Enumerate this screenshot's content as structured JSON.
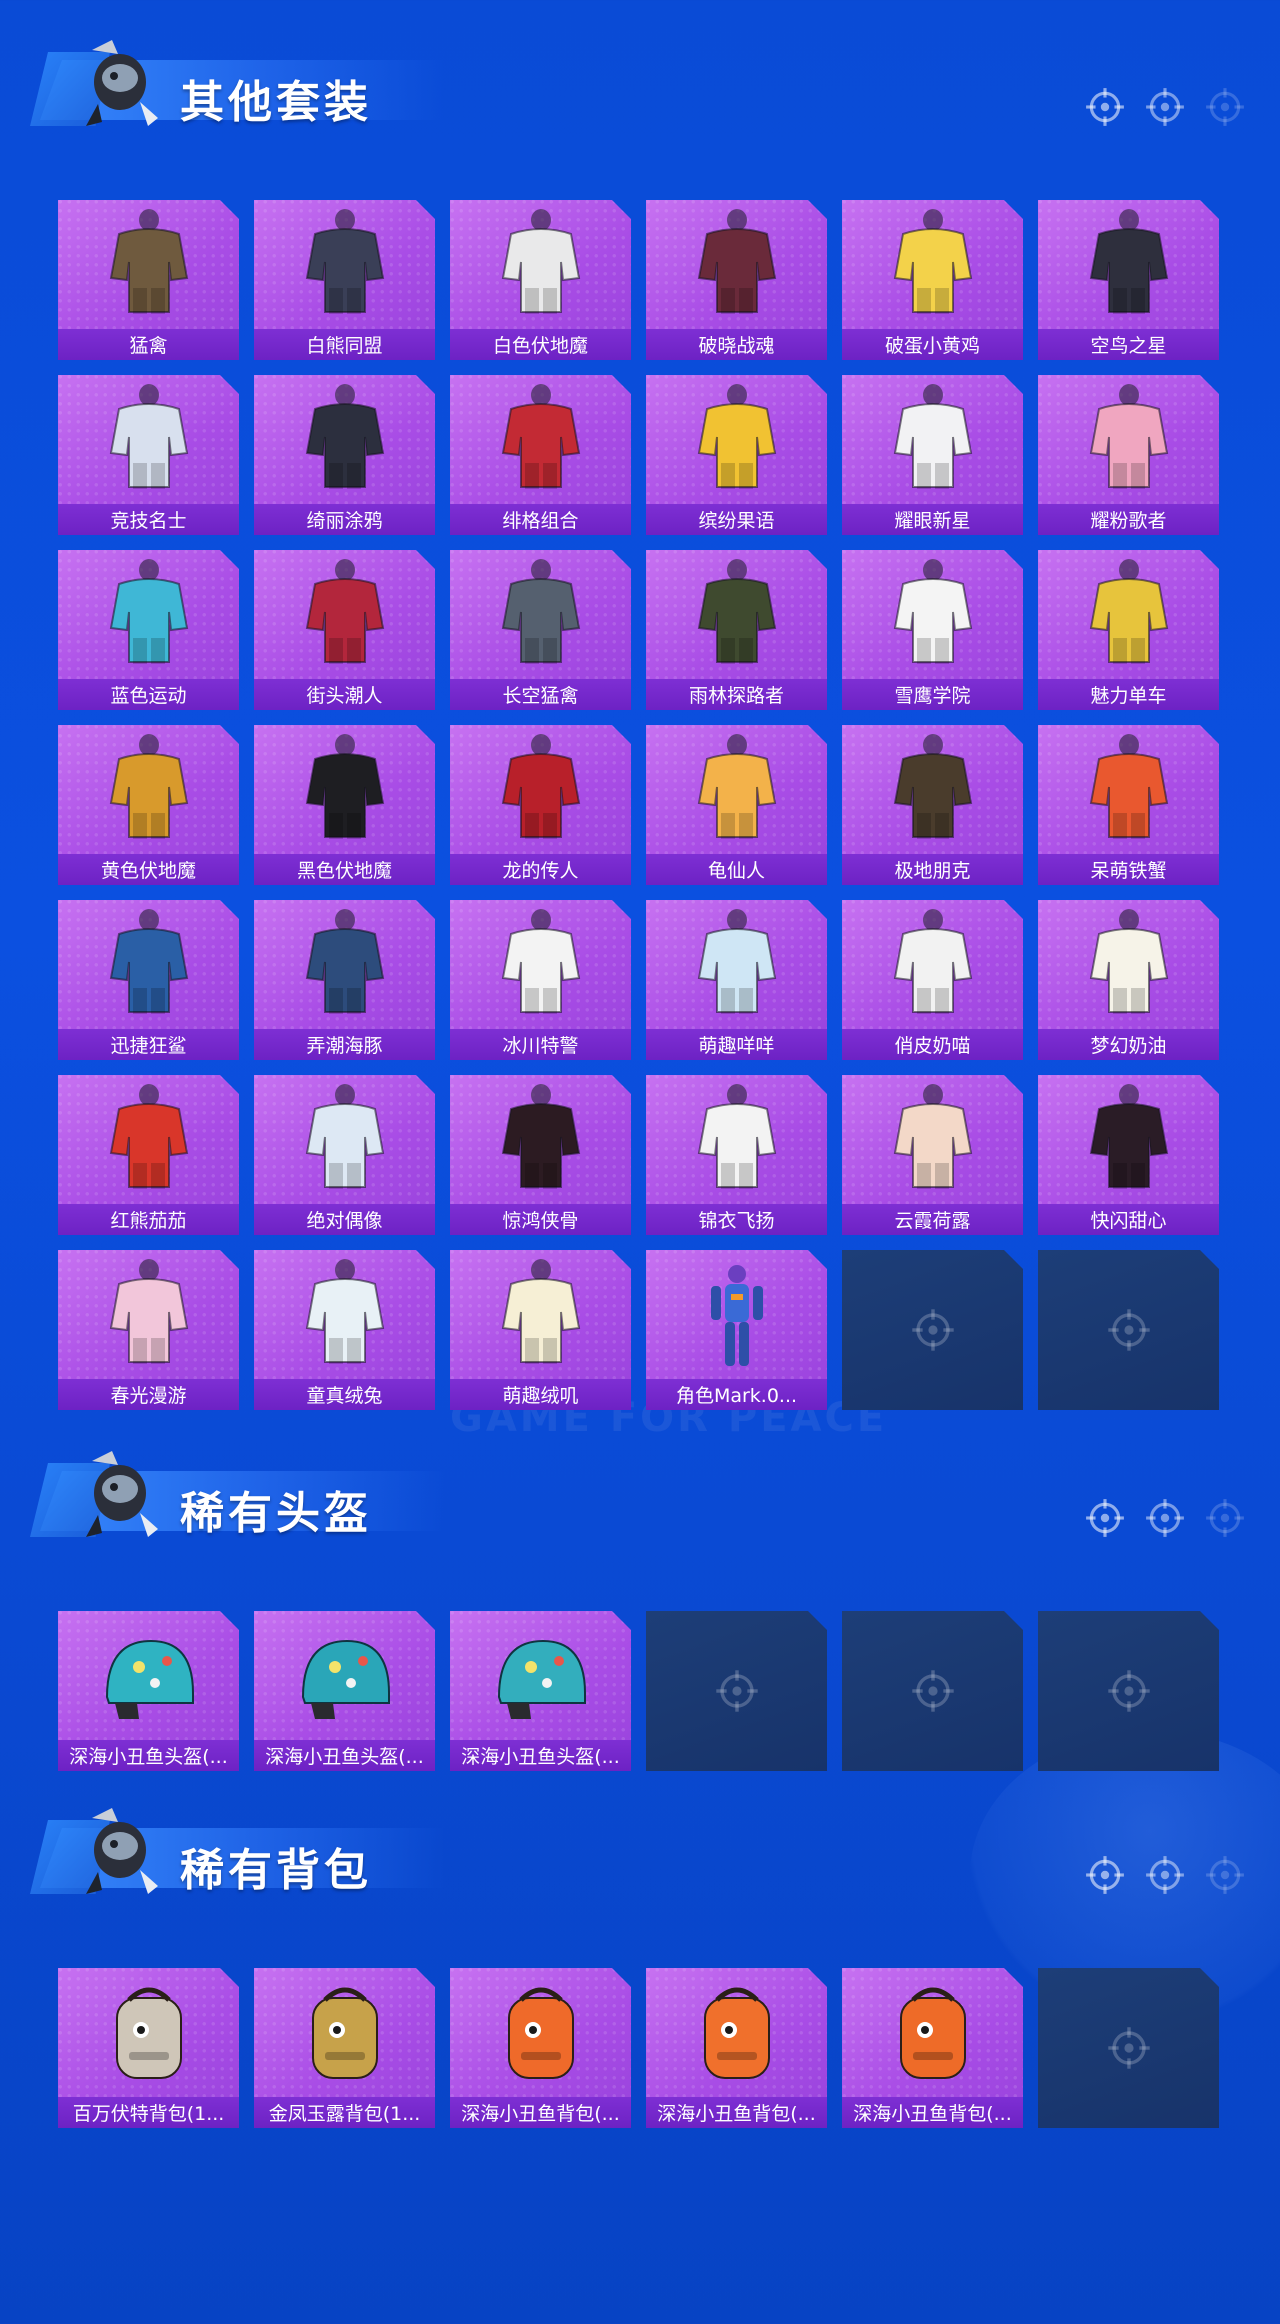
{
  "sections": [
    {
      "title": "其他套装",
      "items": [
        {
          "label": "猛禽",
          "icon": "outfit-icon",
          "color": "#6f5a3e"
        },
        {
          "label": "白熊同盟",
          "icon": "outfit-icon",
          "color": "#3a3f57"
        },
        {
          "label": "白色伏地魔",
          "icon": "outfit-icon",
          "color": "#e9e9ea"
        },
        {
          "label": "破晓战魂",
          "icon": "outfit-icon",
          "color": "#6a2a3a"
        },
        {
          "label": "破蛋小黄鸡",
          "icon": "outfit-icon",
          "color": "#f3d24a"
        },
        {
          "label": "空鸟之星",
          "icon": "outfit-icon",
          "color": "#2e2f3d"
        },
        {
          "label": "竞技名士",
          "icon": "outfit-icon",
          "color": "#d8e0ee"
        },
        {
          "label": "绮丽涂鸦",
          "icon": "outfit-icon",
          "color": "#2c2f3e"
        },
        {
          "label": "绯格组合",
          "icon": "outfit-icon",
          "color": "#c32a34"
        },
        {
          "label": "缤纷果语",
          "icon": "outfit-icon",
          "color": "#f1c232"
        },
        {
          "label": "耀眼新星",
          "icon": "outfit-icon",
          "color": "#f2f2f4"
        },
        {
          "label": "耀粉歌者",
          "icon": "outfit-icon",
          "color": "#f0a6c0"
        },
        {
          "label": "蓝色运动",
          "icon": "outfit-icon",
          "color": "#3fb7d6"
        },
        {
          "label": "街头潮人",
          "icon": "outfit-icon",
          "color": "#b3263c"
        },
        {
          "label": "长空猛禽",
          "icon": "outfit-icon",
          "color": "#55606f"
        },
        {
          "label": "雨林探路者",
          "icon": "outfit-icon",
          "color": "#3f4a2f"
        },
        {
          "label": "雪鹰学院",
          "icon": "outfit-icon",
          "color": "#f4f4f4"
        },
        {
          "label": "魅力单车",
          "icon": "outfit-icon",
          "color": "#e7c43c"
        },
        {
          "label": "黄色伏地魔",
          "icon": "outfit-icon",
          "color": "#d89a2c"
        },
        {
          "label": "黑色伏地魔",
          "icon": "outfit-icon",
          "color": "#1e1e22"
        },
        {
          "label": "龙的传人",
          "icon": "outfit-icon",
          "color": "#b8202a"
        },
        {
          "label": "龟仙人",
          "icon": "outfit-icon",
          "color": "#f3b24a"
        },
        {
          "label": "极地朋克",
          "icon": "outfit-icon",
          "color": "#4a3c2c"
        },
        {
          "label": "呆萌铁蟹",
          "icon": "outfit-icon",
          "color": "#e9582f"
        },
        {
          "label": "迅捷狂鲨",
          "icon": "outfit-icon",
          "color": "#2a5fa6"
        },
        {
          "label": "弄潮海豚",
          "icon": "outfit-icon",
          "color": "#2d4c7c"
        },
        {
          "label": "冰川特警",
          "icon": "outfit-icon",
          "color": "#f3f3f3"
        },
        {
          "label": "萌趣咩咩",
          "icon": "outfit-icon",
          "color": "#cfe6f5"
        },
        {
          "label": "俏皮奶喵",
          "icon": "outfit-icon",
          "color": "#f2f2f2"
        },
        {
          "label": "梦幻奶油",
          "icon": "outfit-icon",
          "color": "#f6f3e8"
        },
        {
          "label": "红熊茄茄",
          "icon": "outfit-icon",
          "color": "#d9362a"
        },
        {
          "label": "绝对偶像",
          "icon": "outfit-icon",
          "color": "#dde8f4"
        },
        {
          "label": "惊鸿侠骨",
          "icon": "outfit-icon",
          "color": "#2c1b22"
        },
        {
          "label": "锦衣飞扬",
          "icon": "outfit-icon",
          "color": "#f3f3f3"
        },
        {
          "label": "云霞荷露",
          "icon": "outfit-icon",
          "color": "#f3d8c8"
        },
        {
          "label": "快闪甜心",
          "icon": "outfit-icon",
          "color": "#2a1c26"
        },
        {
          "label": "春光漫游",
          "icon": "outfit-icon",
          "color": "#f2c6da"
        },
        {
          "label": "童真绒兔",
          "icon": "outfit-icon",
          "color": "#e8f1f6"
        },
        {
          "label": "萌趣绒叽",
          "icon": "outfit-icon",
          "color": "#f6efd5"
        },
        {
          "label": "角色Mark.0...",
          "icon": "mech-suit-icon",
          "color": "#3a6ad6"
        }
      ],
      "total_slots": 42
    },
    {
      "title": "稀有头盔",
      "items": [
        {
          "label": "深海小丑鱼头盔(...",
          "icon": "helmet-icon",
          "color": "#2fb3c2"
        },
        {
          "label": "深海小丑鱼头盔(...",
          "icon": "helmet-icon",
          "color": "#2aa6b8"
        },
        {
          "label": "深海小丑鱼头盔(...",
          "icon": "helmet-icon",
          "color": "#33aebd"
        }
      ],
      "total_slots": 6
    },
    {
      "title": "稀有背包",
      "items": [
        {
          "label": "百万伏特背包(1...",
          "icon": "backpack-icon",
          "color": "#cfc6b8"
        },
        {
          "label": "金凤玉露背包(1...",
          "icon": "backpack-icon",
          "color": "#c7a24a"
        },
        {
          "label": "深海小丑鱼背包(...",
          "icon": "backpack-icon",
          "color": "#ef6a2a"
        },
        {
          "label": "深海小丑鱼背包(...",
          "icon": "backpack-icon",
          "color": "#f0702c"
        },
        {
          "label": "深海小丑鱼背包(...",
          "icon": "backpack-icon",
          "color": "#ee6b28"
        }
      ],
      "total_slots": 6
    }
  ],
  "watermark": "GAME FOR PEACE",
  "colors": {
    "background": "#0a4bd6",
    "card_fill": "#b65ceb",
    "card_label_bar": "#7529cc",
    "empty_slot": "#1b3a72"
  }
}
